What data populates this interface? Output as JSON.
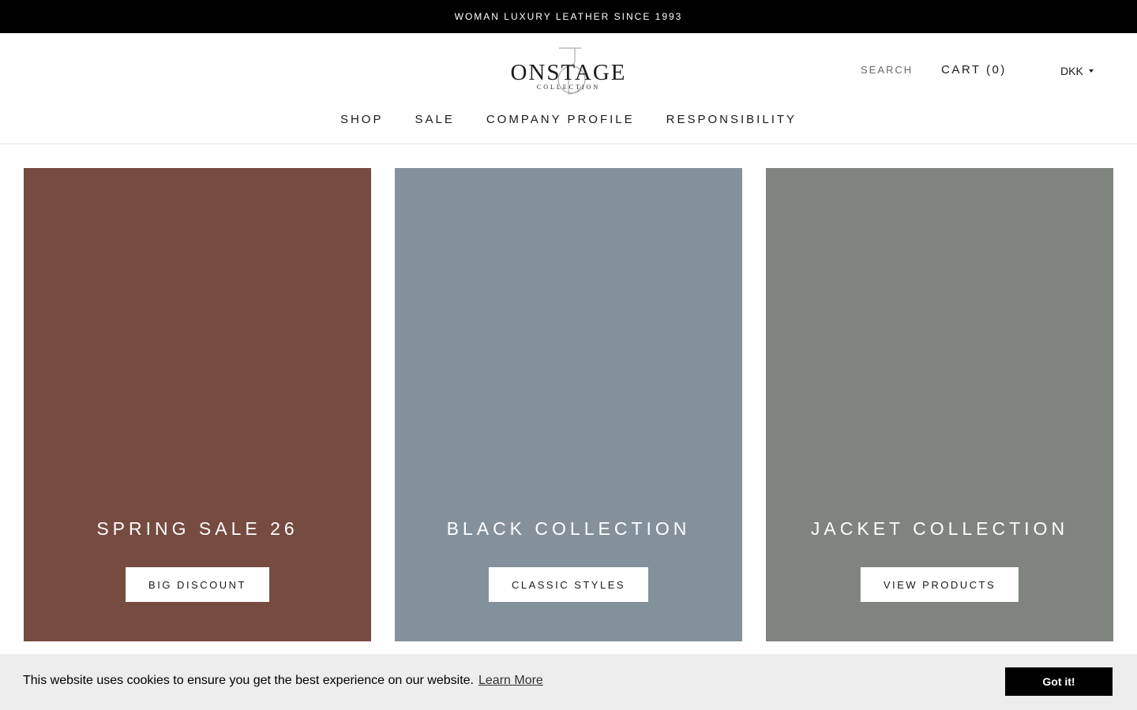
{
  "announcement": {
    "text": "WOMAN LUXURY LEATHER SINCE 1993"
  },
  "logo": {
    "name": "ONSTAGE",
    "subtitle": "COLLECTION"
  },
  "header": {
    "search_label": "SEARCH",
    "cart_label": "CART (0)",
    "currency": "DKK"
  },
  "nav": {
    "items": [
      {
        "label": "SHOP"
      },
      {
        "label": "SALE"
      },
      {
        "label": "COMPANY PROFILE"
      },
      {
        "label": "RESPONSIBILITY"
      }
    ]
  },
  "cards": [
    {
      "title": "SPRING SALE 26",
      "button": "BIG DISCOUNT",
      "color": "#764b40"
    },
    {
      "title": "BLACK COLLECTION",
      "button": "CLASSIC STYLES",
      "color": "#84919b"
    },
    {
      "title": "JACKET COLLECTION",
      "button": "VIEW PRODUCTS",
      "color": "#80847f"
    }
  ],
  "cookie_banner": {
    "message": "This website uses cookies to ensure you get the best experience on our website.",
    "link_label": "Learn More",
    "button_label": "Got it!"
  },
  "colors": {
    "announcement_bg": "#000000",
    "cookie_bg": "#ededed"
  }
}
